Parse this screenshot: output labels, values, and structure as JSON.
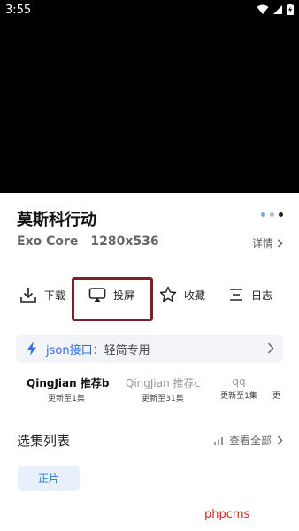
{
  "status_bar": {
    "time": "3:55"
  },
  "video": {
    "title": "莫斯科行动"
  },
  "info": {
    "core": "Exo Core",
    "resolution": "1280x536",
    "details_label": "详情"
  },
  "pager_dots": [
    {
      "color": "#7aa8e6"
    },
    {
      "color": "#9fc0ea"
    },
    {
      "color": "#222222"
    }
  ],
  "actions": {
    "download": "下载",
    "cast": "投屏",
    "favorite": "收藏",
    "log": "日志"
  },
  "source": {
    "label": "json接口：",
    "value": "轻简专用"
  },
  "lines": [
    {
      "name": "QingJian 推荐b",
      "update": "更新至1集",
      "active": true
    },
    {
      "name": "QingJian 推荐c",
      "update": "更新至31集",
      "active": false
    },
    {
      "name": "qq",
      "update": "更新至1集",
      "active": false
    },
    {
      "name": "",
      "update": "更",
      "active": false
    }
  ],
  "episodes": {
    "title": "选集列表",
    "view_all": "查看全部",
    "items": [
      "正片"
    ]
  },
  "watermark": "phpcms",
  "colors": {
    "accent": "#3a78c8",
    "highlight_box": "#7d1f24"
  }
}
